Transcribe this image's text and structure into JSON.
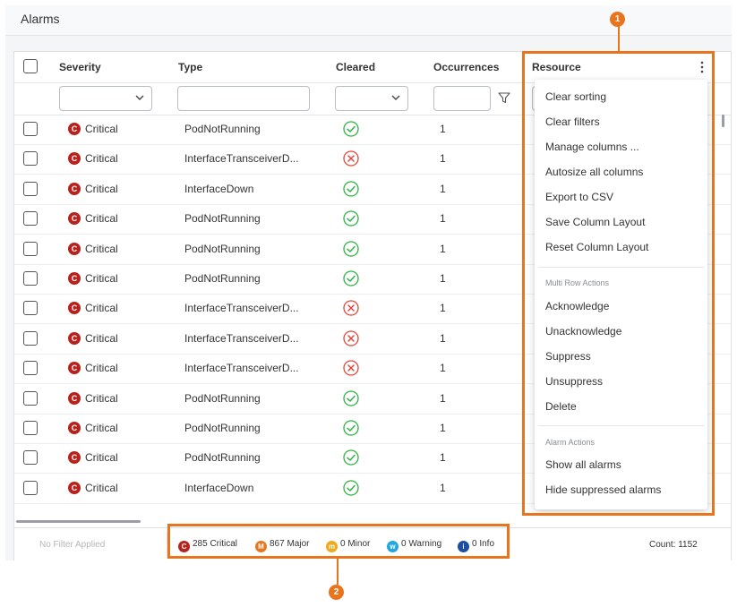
{
  "page": {
    "title": "Alarms"
  },
  "columns": {
    "severity": "Severity",
    "type": "Type",
    "cleared": "Cleared",
    "occurrences": "Occurrences",
    "resource": "Resource"
  },
  "rows": [
    {
      "severity": "Critical",
      "severity_code": "C",
      "type": "PodNotRunning",
      "cleared": true,
      "occurrences": "1"
    },
    {
      "severity": "Critical",
      "severity_code": "C",
      "type": "InterfaceTransceiverD...",
      "cleared": false,
      "occurrences": "1"
    },
    {
      "severity": "Critical",
      "severity_code": "C",
      "type": "InterfaceDown",
      "cleared": true,
      "occurrences": "1"
    },
    {
      "severity": "Critical",
      "severity_code": "C",
      "type": "PodNotRunning",
      "cleared": true,
      "occurrences": "1"
    },
    {
      "severity": "Critical",
      "severity_code": "C",
      "type": "PodNotRunning",
      "cleared": true,
      "occurrences": "1"
    },
    {
      "severity": "Critical",
      "severity_code": "C",
      "type": "PodNotRunning",
      "cleared": true,
      "occurrences": "1"
    },
    {
      "severity": "Critical",
      "severity_code": "C",
      "type": "InterfaceTransceiverD...",
      "cleared": false,
      "occurrences": "1"
    },
    {
      "severity": "Critical",
      "severity_code": "C",
      "type": "InterfaceTransceiverD...",
      "cleared": false,
      "occurrences": "1"
    },
    {
      "severity": "Critical",
      "severity_code": "C",
      "type": "InterfaceTransceiverD...",
      "cleared": false,
      "occurrences": "1"
    },
    {
      "severity": "Critical",
      "severity_code": "C",
      "type": "PodNotRunning",
      "cleared": true,
      "occurrences": "1"
    },
    {
      "severity": "Critical",
      "severity_code": "C",
      "type": "PodNotRunning",
      "cleared": true,
      "occurrences": "1"
    },
    {
      "severity": "Critical",
      "severity_code": "C",
      "type": "PodNotRunning",
      "cleared": true,
      "occurrences": "1"
    },
    {
      "severity": "Critical",
      "severity_code": "C",
      "type": "InterfaceDown",
      "cleared": true,
      "occurrences": "1"
    }
  ],
  "column_menu": {
    "items": [
      "Clear sorting",
      "Clear filters",
      "Manage columns ...",
      "Autosize all columns",
      "Export to CSV",
      "Save Column Layout",
      "Reset Column Layout"
    ],
    "multi_row_section": "Multi Row Actions",
    "multi_row_items": [
      "Acknowledge",
      "Unacknowledge",
      "Suppress",
      "Unsuppress",
      "Delete"
    ],
    "alarm_section": "Alarm Actions",
    "alarm_items": [
      "Show all alarms",
      "Hide suppressed alarms"
    ]
  },
  "footer": {
    "filter_status": "No Filter Applied",
    "summary": [
      {
        "badge": "C",
        "label": "285 Critical",
        "color": "#b8221c"
      },
      {
        "badge": "M",
        "label": "867 Major",
        "color": "#e8761f"
      },
      {
        "badge": "m",
        "label": "0 Minor",
        "color": "#f0a81c"
      },
      {
        "badge": "w",
        "label": "0 Warning",
        "color": "#22a7e0"
      },
      {
        "badge": "i",
        "label": "0 Info",
        "color": "#1d4ea0"
      }
    ],
    "count": "Count: 1152"
  },
  "callouts": {
    "resource_menu": "1",
    "summary_bar": "2"
  },
  "colors": {
    "accent": "#e8741e",
    "cleared_ok": "#2fb344",
    "cleared_no": "#e0473c",
    "critical": "#b8221c"
  }
}
